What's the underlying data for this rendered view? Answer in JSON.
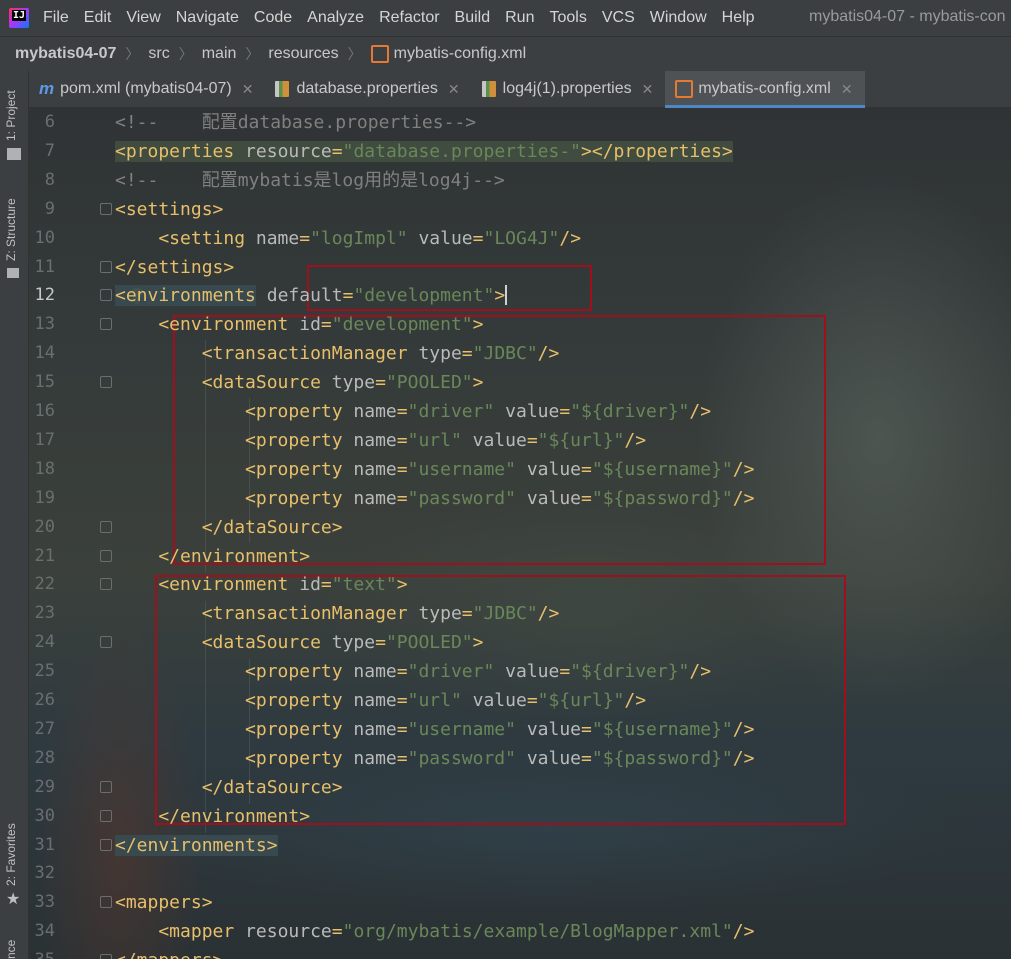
{
  "menu": {
    "items": [
      "File",
      "Edit",
      "View",
      "Navigate",
      "Code",
      "Analyze",
      "Refactor",
      "Build",
      "Run",
      "Tools",
      "VCS",
      "Window",
      "Help"
    ],
    "window_title": "mybatis04-07 - mybatis-con"
  },
  "breadcrumb": {
    "project": "mybatis04-07",
    "items": [
      "src",
      "main",
      "resources"
    ],
    "file": "mybatis-config.xml"
  },
  "toolstrip": {
    "project": "1: Project",
    "structure": "Z: Structure",
    "favorites": "2: Favorites",
    "bottom": "nce"
  },
  "tabs": [
    {
      "label": "pom.xml (mybatis04-07)",
      "icon": "maven-icon",
      "active": false
    },
    {
      "label": "database.properties",
      "icon": "properties-file-icon",
      "active": false
    },
    {
      "label": "log4j(1).properties",
      "icon": "properties-file-icon",
      "active": false
    },
    {
      "label": "mybatis-config.xml",
      "icon": "xml-file-icon",
      "active": true
    }
  ],
  "editor": {
    "current_line": 12,
    "lines": [
      {
        "n": "6",
        "s": [
          [
            "c-comment",
            "<!--    配置database.properties-->"
          ]
        ]
      },
      {
        "n": "7",
        "s": [
          [
            "c-tag hl",
            "<properties"
          ],
          [
            "c-attr hl",
            " resource"
          ],
          [
            "c-punc hl",
            "="
          ],
          [
            "c-val hl",
            "\"database.properties-\""
          ],
          [
            "c-tag hl",
            "></properties>"
          ]
        ]
      },
      {
        "n": "8",
        "s": [
          [
            "c-comment",
            "<!--    配置mybatis是log用的是log4j-->"
          ]
        ]
      },
      {
        "n": "9",
        "s": [
          [
            "c-tag",
            "<settings>"
          ]
        ]
      },
      {
        "n": "10",
        "s": [
          [
            "c-tag",
            "    <setting"
          ],
          [
            "c-attr",
            " name"
          ],
          [
            "c-punc",
            "="
          ],
          [
            "c-val",
            "\"logImpl\""
          ],
          [
            "c-attr",
            " value"
          ],
          [
            "c-punc",
            "="
          ],
          [
            "c-val",
            "\"LOG4J\""
          ],
          [
            "c-tag",
            "/>"
          ]
        ]
      },
      {
        "n": "11",
        "s": [
          [
            "c-tag",
            "</settings>"
          ]
        ]
      },
      {
        "n": "12",
        "s": [
          [
            "c-tag hl2",
            "<environments"
          ],
          [
            "c-attr",
            " default"
          ],
          [
            "c-punc",
            "="
          ],
          [
            "c-val",
            "\"development\""
          ],
          [
            "c-tag",
            ">"
          ]
        ]
      },
      {
        "n": "13",
        "s": [
          [
            "c-tag",
            "    <environment"
          ],
          [
            "c-attr",
            " id"
          ],
          [
            "c-punc",
            "="
          ],
          [
            "c-val",
            "\"development\""
          ],
          [
            "c-tag",
            ">"
          ]
        ]
      },
      {
        "n": "14",
        "s": [
          [
            "c-tag",
            "        <transactionManager"
          ],
          [
            "c-attr",
            " type"
          ],
          [
            "c-punc",
            "="
          ],
          [
            "c-val",
            "\"JDBC\""
          ],
          [
            "c-tag",
            "/>"
          ]
        ]
      },
      {
        "n": "15",
        "s": [
          [
            "c-tag",
            "        <dataSource"
          ],
          [
            "c-attr",
            " type"
          ],
          [
            "c-punc",
            "="
          ],
          [
            "c-val",
            "\"POOLED\""
          ],
          [
            "c-tag",
            ">"
          ]
        ]
      },
      {
        "n": "16",
        "s": [
          [
            "c-tag",
            "            <property"
          ],
          [
            "c-attr",
            " name"
          ],
          [
            "c-punc",
            "="
          ],
          [
            "c-val",
            "\"driver\""
          ],
          [
            "c-attr",
            " value"
          ],
          [
            "c-punc",
            "="
          ],
          [
            "c-val",
            "\"${driver}\""
          ],
          [
            "c-tag",
            "/>"
          ]
        ]
      },
      {
        "n": "17",
        "s": [
          [
            "c-tag",
            "            <property"
          ],
          [
            "c-attr",
            " name"
          ],
          [
            "c-punc",
            "="
          ],
          [
            "c-val",
            "\"url\""
          ],
          [
            "c-attr",
            " value"
          ],
          [
            "c-punc",
            "="
          ],
          [
            "c-val",
            "\"${url}\""
          ],
          [
            "c-tag",
            "/>"
          ]
        ]
      },
      {
        "n": "18",
        "s": [
          [
            "c-tag",
            "            <property"
          ],
          [
            "c-attr",
            " name"
          ],
          [
            "c-punc",
            "="
          ],
          [
            "c-val",
            "\"username\""
          ],
          [
            "c-attr",
            " value"
          ],
          [
            "c-punc",
            "="
          ],
          [
            "c-val",
            "\"${username}\""
          ],
          [
            "c-tag",
            "/>"
          ]
        ]
      },
      {
        "n": "19",
        "s": [
          [
            "c-tag",
            "            <property"
          ],
          [
            "c-attr",
            " name"
          ],
          [
            "c-punc",
            "="
          ],
          [
            "c-val",
            "\"password\""
          ],
          [
            "c-attr",
            " value"
          ],
          [
            "c-punc",
            "="
          ],
          [
            "c-val",
            "\"${password}\""
          ],
          [
            "c-tag",
            "/>"
          ]
        ]
      },
      {
        "n": "20",
        "s": [
          [
            "c-tag",
            "        </dataSource>"
          ]
        ]
      },
      {
        "n": "21",
        "s": [
          [
            "c-tag",
            "    </environment>"
          ]
        ]
      },
      {
        "n": "22",
        "s": [
          [
            "c-tag",
            "    <environment"
          ],
          [
            "c-attr",
            " id"
          ],
          [
            "c-punc",
            "="
          ],
          [
            "c-val",
            "\"text\""
          ],
          [
            "c-tag",
            ">"
          ]
        ]
      },
      {
        "n": "23",
        "s": [
          [
            "c-tag",
            "        <transactionManager"
          ],
          [
            "c-attr",
            " type"
          ],
          [
            "c-punc",
            "="
          ],
          [
            "c-val",
            "\"JDBC\""
          ],
          [
            "c-tag",
            "/>"
          ]
        ]
      },
      {
        "n": "24",
        "s": [
          [
            "c-tag",
            "        <dataSource"
          ],
          [
            "c-attr",
            " type"
          ],
          [
            "c-punc",
            "="
          ],
          [
            "c-val",
            "\"POOLED\""
          ],
          [
            "c-tag",
            ">"
          ]
        ]
      },
      {
        "n": "25",
        "s": [
          [
            "c-tag",
            "            <property"
          ],
          [
            "c-attr",
            " name"
          ],
          [
            "c-punc",
            "="
          ],
          [
            "c-val",
            "\"driver\""
          ],
          [
            "c-attr",
            " value"
          ],
          [
            "c-punc",
            "="
          ],
          [
            "c-val",
            "\"${driver}\""
          ],
          [
            "c-tag",
            "/>"
          ]
        ]
      },
      {
        "n": "26",
        "s": [
          [
            "c-tag",
            "            <property"
          ],
          [
            "c-attr",
            " name"
          ],
          [
            "c-punc",
            "="
          ],
          [
            "c-val",
            "\"url\""
          ],
          [
            "c-attr",
            " value"
          ],
          [
            "c-punc",
            "="
          ],
          [
            "c-val",
            "\"${url}\""
          ],
          [
            "c-tag",
            "/>"
          ]
        ]
      },
      {
        "n": "27",
        "s": [
          [
            "c-tag",
            "            <property"
          ],
          [
            "c-attr",
            " name"
          ],
          [
            "c-punc",
            "="
          ],
          [
            "c-val",
            "\"username\""
          ],
          [
            "c-attr",
            " value"
          ],
          [
            "c-punc",
            "="
          ],
          [
            "c-val",
            "\"${username}\""
          ],
          [
            "c-tag",
            "/>"
          ]
        ]
      },
      {
        "n": "28",
        "s": [
          [
            "c-tag",
            "            <property"
          ],
          [
            "c-attr",
            " name"
          ],
          [
            "c-punc",
            "="
          ],
          [
            "c-val",
            "\"password\""
          ],
          [
            "c-attr",
            " value"
          ],
          [
            "c-punc",
            "="
          ],
          [
            "c-val",
            "\"${password}\""
          ],
          [
            "c-tag",
            "/>"
          ]
        ]
      },
      {
        "n": "29",
        "s": [
          [
            "c-tag",
            "        </dataSource>"
          ]
        ]
      },
      {
        "n": "30",
        "s": [
          [
            "c-tag",
            "    </environment>"
          ]
        ]
      },
      {
        "n": "31",
        "s": [
          [
            "c-tag hl2",
            "</environments>"
          ]
        ]
      },
      {
        "n": "32",
        "s": []
      },
      {
        "n": "33",
        "s": [
          [
            "c-tag",
            "<mappers>"
          ]
        ]
      },
      {
        "n": "34",
        "s": [
          [
            "c-tag",
            "    <mapper"
          ],
          [
            "c-attr",
            " resource"
          ],
          [
            "c-punc",
            "="
          ],
          [
            "c-val",
            "\"org/mybatis/example/BlogMapper.xml\""
          ],
          [
            "c-tag",
            "/>"
          ]
        ]
      },
      {
        "n": "35",
        "s": [
          [
            "c-tag",
            "</mappers>"
          ]
        ]
      }
    ]
  }
}
